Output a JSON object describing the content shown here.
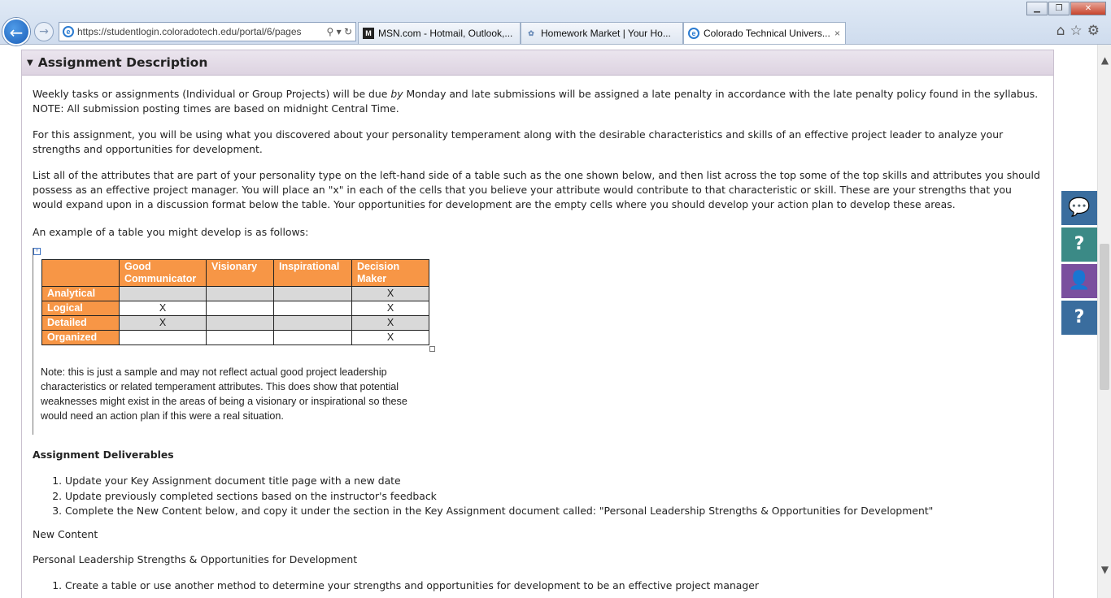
{
  "browser": {
    "url": "https://studentlogin.coloradotech.edu/portal/6/pages",
    "tabs": [
      {
        "label": "MSN.com - Hotmail, Outlook,...",
        "icon": "msn-icon",
        "active": false
      },
      {
        "label": "Homework Market | Your Ho...",
        "icon": "homework-market-icon",
        "active": false
      },
      {
        "label": "Colorado Technical Univers...",
        "icon": "ie-icon",
        "active": true
      }
    ],
    "close_glyph": "×"
  },
  "section": {
    "title": "Assignment Description",
    "p1_a": "Weekly tasks or assignments (Individual or Group Projects) will be due ",
    "p1_em": "by",
    "p1_b": " Monday and late submissions will be assigned a late penalty in accordance with the late penalty policy found in the syllabus.",
    "p1_c": "NOTE: All submission posting times are based on midnight Central Time.",
    "p2": "For this assignment, you will be using what you discovered about your personality temperament along with the desirable characteristics and skills of an effective project leader to analyze your strengths and opportunities for development.",
    "p3": "List all of the attributes that are part of your personality type on the left-hand side of a table such as the one shown below, and then list across the top some of the top skills and attributes you should possess as an effective project manager. You will place an \"x\" in each of the cells that you believe your attribute would contribute to that characteristic or skill. These are your strengths that you would expand upon in a discussion format below the table. Your opportunities for development are the empty cells where you should develop your action plan to develop these areas.",
    "p4": "An example of a table you might develop is as follows:"
  },
  "sample_table": {
    "columns": [
      "Good Communicator",
      "Visionary",
      "Inspirational",
      "Decision Maker"
    ],
    "rows": [
      {
        "label": "Analytical",
        "cells": [
          "",
          "",
          "",
          "X"
        ]
      },
      {
        "label": "Logical",
        "cells": [
          "X",
          "",
          "",
          "X"
        ]
      },
      {
        "label": "Detailed",
        "cells": [
          "X",
          "",
          "",
          "X"
        ]
      },
      {
        "label": "Organized",
        "cells": [
          "",
          "",
          "",
          "X"
        ]
      }
    ],
    "header_color": "#f79646",
    "stripe_color": "#d9d9d9"
  },
  "note": "Note: this is just a sample and may not reflect actual good project leadership characteristics or related temperament attributes. This does show that potential weaknesses might exist in the areas of being a visionary or inspirational so these would need an action plan if this were a real situation.",
  "deliverables": {
    "heading": "Assignment Deliverables",
    "items": [
      "Update your Key Assignment document title page with a new date",
      "Update previously completed sections based on the instructor's feedback",
      "Complete the New Content below, and copy it under the section in the Key Assignment document called: \"Personal Leadership Strengths & Opportunities for Development\""
    ]
  },
  "new_content": {
    "label": "New Content",
    "subheading": "Personal Leadership Strengths & Opportunities for Development",
    "items": [
      "Create a table or use another method to determine your strengths and opportunities for development to be an effective project manager"
    ]
  },
  "widgets": [
    "chat-icon",
    "help-icon",
    "contact-icon",
    "faq-chat-icon"
  ]
}
